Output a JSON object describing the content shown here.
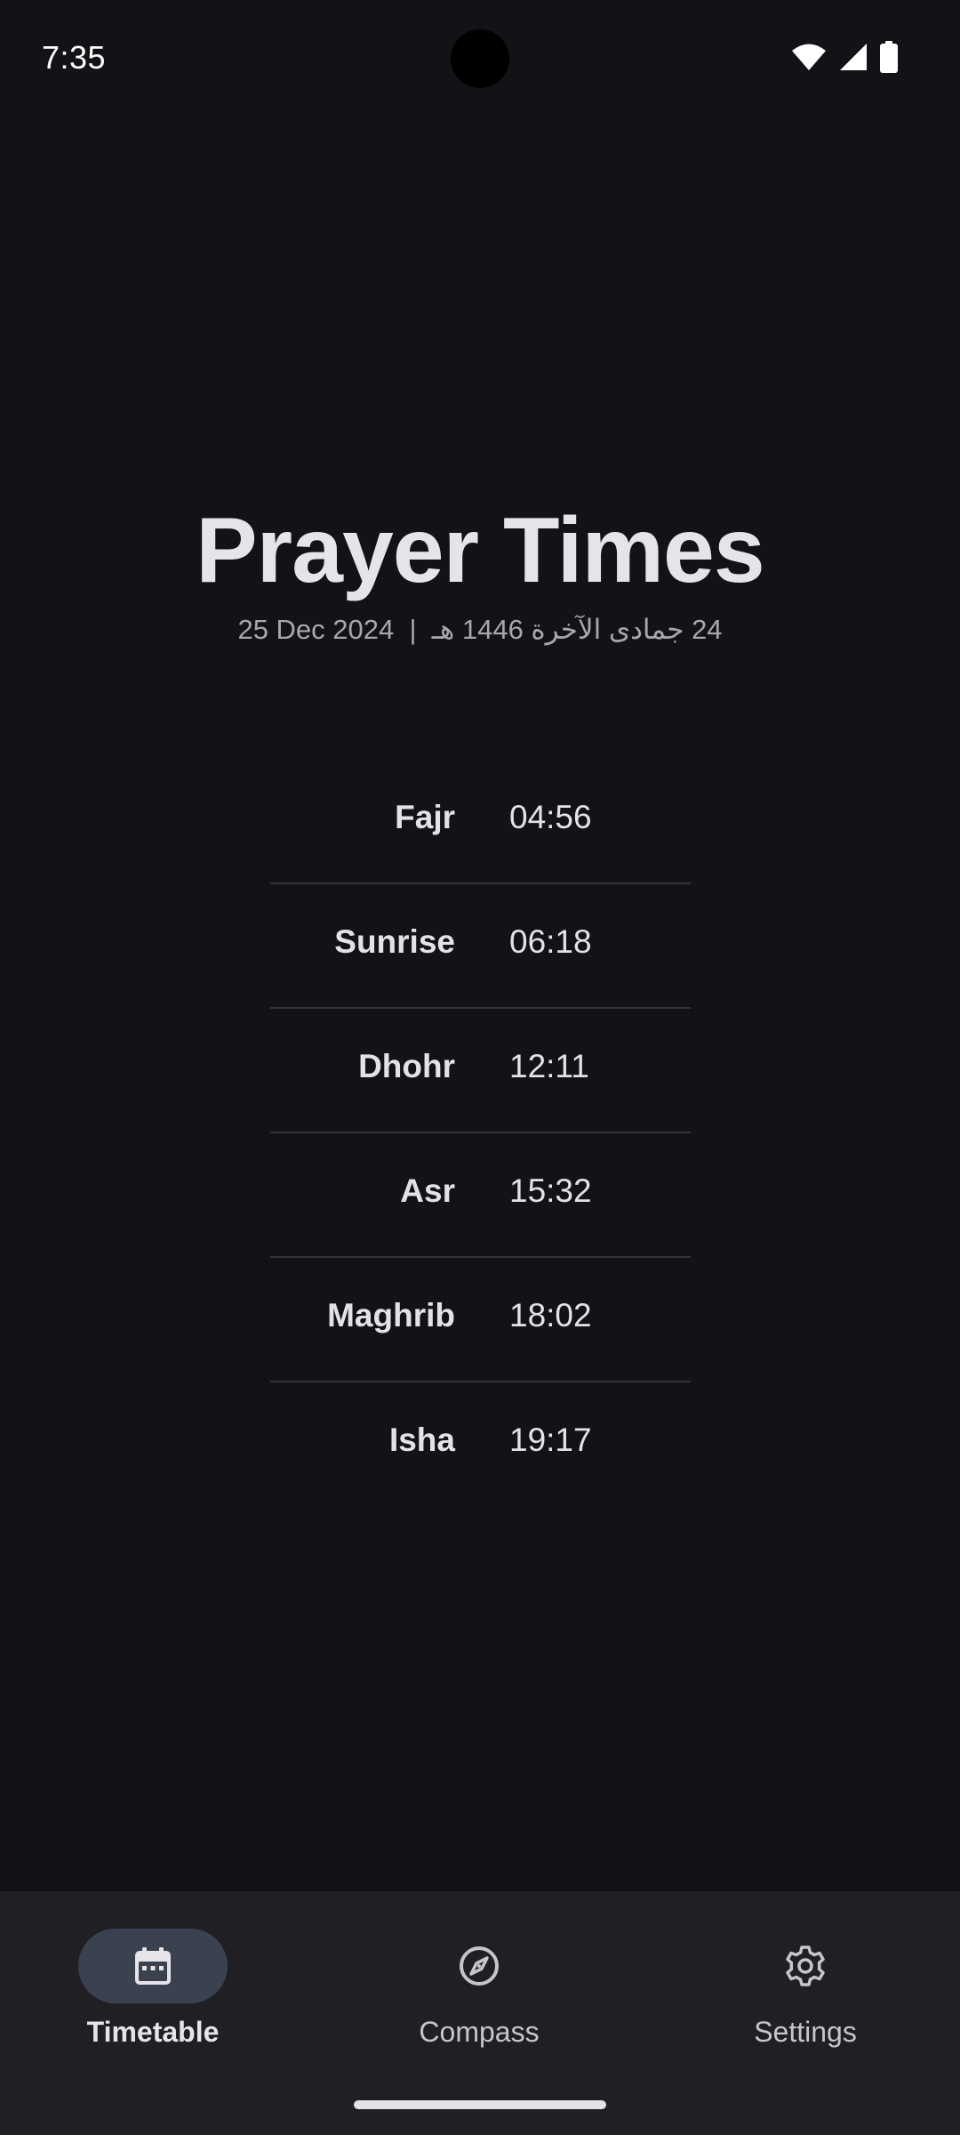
{
  "status_bar": {
    "time": "7:35"
  },
  "header": {
    "title": "Prayer Times",
    "gregorian_date": "25 Dec 2024",
    "separator": "|",
    "hijri_date": "24 جمادى الآخرة 1446 هـ"
  },
  "prayers": [
    {
      "name": "Fajr",
      "time": "04:56"
    },
    {
      "name": "Sunrise",
      "time": "06:18"
    },
    {
      "name": "Dhohr",
      "time": "12:11"
    },
    {
      "name": "Asr",
      "time": "15:32"
    },
    {
      "name": "Maghrib",
      "time": "18:02"
    },
    {
      "name": "Isha",
      "time": "19:17"
    }
  ],
  "bottom_nav": {
    "items": [
      {
        "label": "Timetable",
        "icon": "calendar-icon",
        "active": true
      },
      {
        "label": "Compass",
        "icon": "compass-icon",
        "active": false
      },
      {
        "label": "Settings",
        "icon": "gear-icon",
        "active": false
      }
    ]
  },
  "colors": {
    "background": "#131317",
    "nav_background": "#1f1f24",
    "active_pill": "#3a4250",
    "text_primary": "#e4e2e6",
    "text_secondary": "#a9a7ad",
    "divider": "#34333a"
  }
}
